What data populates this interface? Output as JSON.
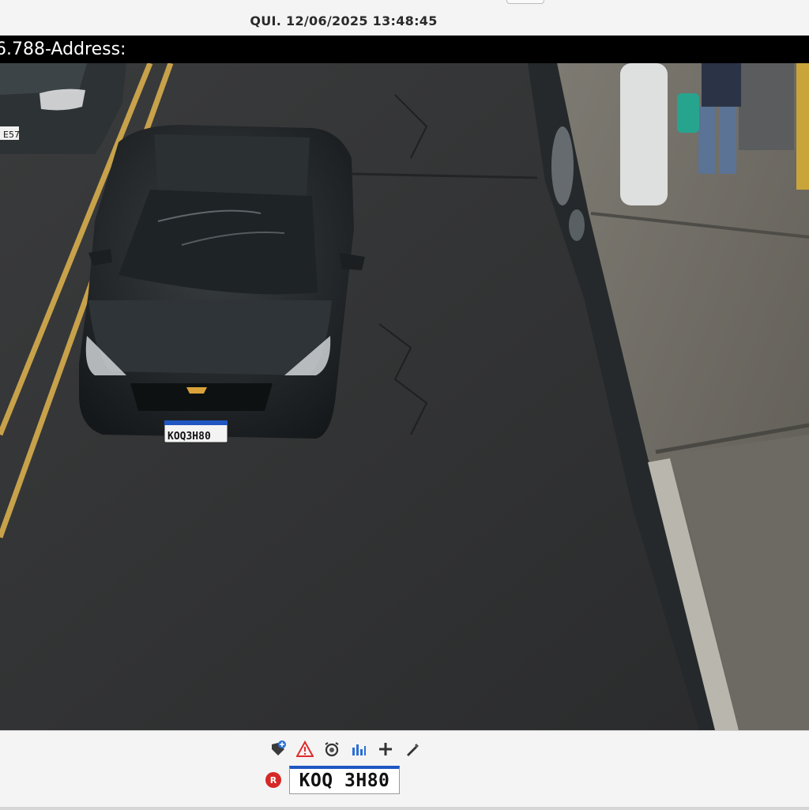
{
  "header": {
    "timestamp": "QUI. 12/06/2025 13:48:45"
  },
  "overlay": {
    "text": "6.788-Address:"
  },
  "scene": {
    "main_vehicle_plate": "KOQ3H80",
    "parked_vehicle_plate": "E57"
  },
  "toolbar": {
    "tools": [
      {
        "name": "add-tag-icon",
        "color": "#2b6fd6"
      },
      {
        "name": "warning-icon",
        "color": "#e02b2b"
      },
      {
        "name": "alarm-icon",
        "color": "#333333"
      },
      {
        "name": "bar-chart-icon",
        "color": "#2b6fd6"
      },
      {
        "name": "plus-icon",
        "color": "#333333"
      },
      {
        "name": "pencil-icon",
        "color": "#333333"
      }
    ]
  },
  "plate_reader": {
    "badge": "R",
    "value": "KOQ 3H80",
    "accent_color": "#1f56c2"
  }
}
